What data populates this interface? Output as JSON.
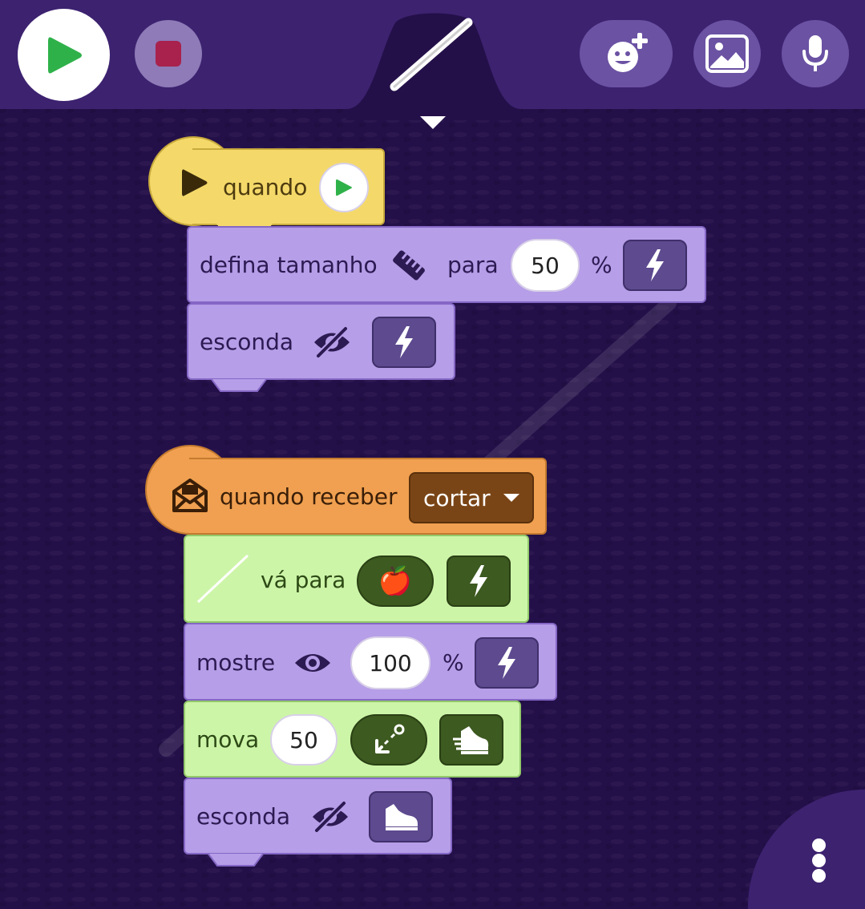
{
  "toolbar": {
    "play_icon": "play-icon",
    "stop_icon": "stop-icon",
    "stage_preview": "line-preview",
    "add_character_icon": "add-character-icon",
    "background_icon": "image-icon",
    "sound_icon": "microphone-icon"
  },
  "script1": {
    "hat_label": "quando",
    "hat_icon": "play-icon",
    "trigger_icon": "play-flag-icon",
    "blocks": [
      {
        "label": "defina tamanho",
        "icon": "ruler-icon",
        "label2": "para",
        "value": "50",
        "unit": "%",
        "speed_icon": "lightning-icon"
      },
      {
        "label": "esconda",
        "icon": "eye-off-icon",
        "speed_icon": "lightning-icon"
      }
    ]
  },
  "script2": {
    "hat_label": "quando receber",
    "hat_icon": "envelope-icon",
    "message": "cortar",
    "blocks": [
      {
        "label": "vá para",
        "target": "🍎",
        "speed_icon": "lightning-icon"
      },
      {
        "label": "mostre",
        "icon": "eye-icon",
        "value": "100",
        "unit": "%",
        "speed_icon": "lightning-icon"
      },
      {
        "label": "mova",
        "value": "50",
        "direction_icon": "arrow-down-left-icon",
        "speed_icon": "sneaker-fast-icon"
      },
      {
        "label": "esconda",
        "icon": "eye-off-icon",
        "speed_icon": "sneaker-icon"
      }
    ]
  },
  "colors": {
    "background": "#241049",
    "toolbar": "#3d2270",
    "yellow_hat": "#f4d96a",
    "orange_hat": "#f0a050",
    "purple_block": "#b69ee8",
    "green_block": "#cdf5a8",
    "play_green": "#2fb14a",
    "stop_red": "#a8224d"
  },
  "menu": {
    "icon": "more-vertical-icon"
  }
}
